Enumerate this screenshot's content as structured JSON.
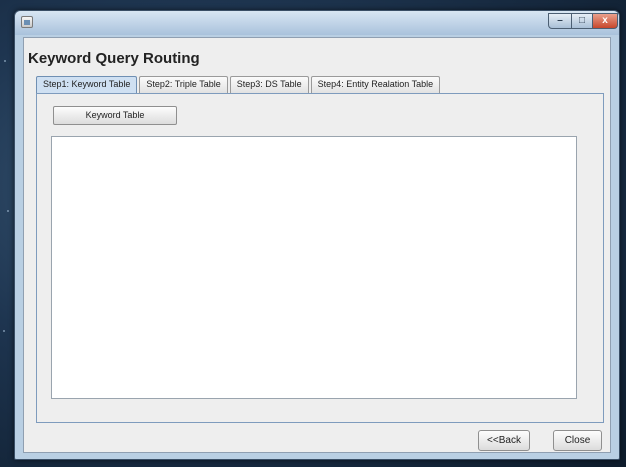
{
  "window": {
    "title_text": "",
    "app_title": "Keyword Query Routing",
    "controls": {
      "minimize": "–",
      "maximize": "□",
      "close": "x"
    }
  },
  "tabs": [
    {
      "label": "Step1: Keyword Table",
      "active": true
    },
    {
      "label": "Step2: Triple Table",
      "active": false
    },
    {
      "label": "Step3: DS Table",
      "active": false
    },
    {
      "label": "Step4: Entity Realation Table",
      "active": false
    }
  ],
  "panel": {
    "button_label": "Keyword Table",
    "table_rows": []
  },
  "footer": {
    "back_label": "<<Back",
    "close_label": "Close"
  },
  "colors": {
    "active_tab": "#cfe0f2",
    "window_frame": "#b9cfe3",
    "close_button": "#c7472c"
  }
}
